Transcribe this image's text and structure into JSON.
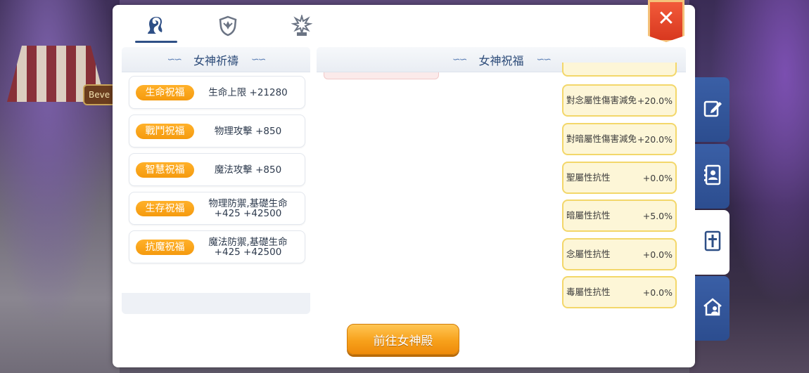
{
  "top_tabs": [
    {
      "icon": "goddess-icon",
      "active": true
    },
    {
      "icon": "shield-icon",
      "active": false
    },
    {
      "icon": "guild-emblem-icon",
      "active": false
    }
  ],
  "close_button": {
    "icon": "close-icon",
    "glyph": "✕"
  },
  "left_panel": {
    "title": "女神祈禱",
    "blessings": [
      {
        "tag": "生命祝福",
        "value": "生命上限 +21280"
      },
      {
        "tag": "戰鬥祝福",
        "value": "物理攻擊 +850"
      },
      {
        "tag": "智慧祝福",
        "value": "魔法攻擊 +850"
      },
      {
        "tag": "生存祝福",
        "value": "物理防禦,基礎生命 +425 +42500"
      },
      {
        "tag": "抗魔祝福",
        "value": "魔法防禦,基礎生命 +425 +42500"
      }
    ]
  },
  "right_panel": {
    "title": "女神祝福",
    "stats": [
      {
        "name": "對念屬性傷害減免",
        "value": "+20.0%"
      },
      {
        "name": "對暗屬性傷害減免",
        "value": "+20.0%"
      },
      {
        "name": "聖屬性抗性",
        "value": "+0.0%"
      },
      {
        "name": "暗屬性抗性",
        "value": "+5.0%"
      },
      {
        "name": "念屬性抗性",
        "value": "+0.0%"
      },
      {
        "name": "毒屬性抗性",
        "value": "+0.0%"
      }
    ]
  },
  "go_button": {
    "label": "前往女神殿"
  },
  "side_nav": [
    {
      "icon": "edit-icon",
      "active": false
    },
    {
      "icon": "contacts-icon",
      "active": false
    },
    {
      "icon": "cross-book-icon",
      "active": true
    },
    {
      "icon": "house-user-icon",
      "active": false
    }
  ],
  "background": {
    "sign_text": "Beve"
  },
  "colors": {
    "accent_blue": "#2e4f86",
    "tag_orange": "#f59a0e",
    "stat_card_bg": "#fdf6d7",
    "stat_card_border": "#f3d76a",
    "close_red": "#d8381f"
  }
}
